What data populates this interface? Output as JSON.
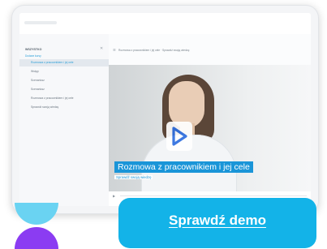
{
  "sidebar": {
    "title": "WSZYSTKO",
    "subtitle": "Dodane kursy",
    "items": [
      {
        "label": "Rozmowa z pracownikiem i jej cele"
      },
      {
        "label": "Wstęp"
      },
      {
        "label": "Scenariusz"
      },
      {
        "label": "Scenariusz"
      },
      {
        "label": "Rozmowa z pracownikiem i jej cele"
      },
      {
        "label": "Sprawdź swoją wiedzę"
      }
    ]
  },
  "main": {
    "breadcrumb": "Rozmowa z pracownikiem i jej cele · Sprawdź swoją wiedzę",
    "video": {
      "caption": "Rozmowa z pracownikiem i jej cele",
      "caption_sub": "Sprawdź swoją wiedzę"
    }
  },
  "cta": {
    "label": "Sprawdź demo"
  },
  "colors": {
    "accent": "#13b3e8",
    "caption_bg": "#1a95d8",
    "deco_cyan": "#6ad3f2",
    "deco_purple": "#8b3cf2"
  },
  "icons": [
    "close-icon",
    "menu-icon",
    "play-icon"
  ]
}
